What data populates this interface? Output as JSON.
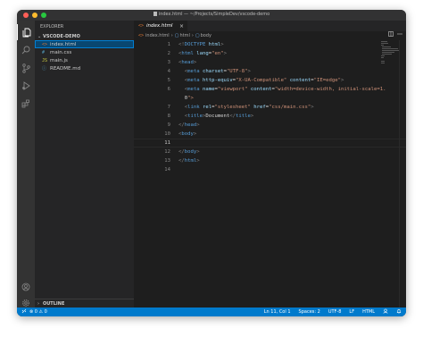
{
  "window": {
    "title": "index.html — ~/Projects/SimpleDev/vscode-demo"
  },
  "colors": {
    "accent": "#007acc",
    "selection": "#094771",
    "traffic_close": "#ff5f57",
    "traffic_min": "#febc2e",
    "traffic_max": "#28c840"
  },
  "activity_bar": {
    "icons": [
      "files-icon",
      "search-icon",
      "source-control-icon",
      "run-debug-icon",
      "extensions-icon",
      "account-icon",
      "settings-gear-icon"
    ]
  },
  "sidebar": {
    "title": "EXPLORER",
    "folder": "VSCODE-DEMO",
    "folder_chevron": "⌄",
    "files": [
      {
        "name": "index.html",
        "icon": "<>",
        "icon_color": "#e37933",
        "selected": true
      },
      {
        "name": "main.css",
        "icon": "#",
        "icon_color": "#519aba",
        "selected": false
      },
      {
        "name": "main.js",
        "icon": "JS",
        "icon_color": "#cbcb41",
        "selected": false
      },
      {
        "name": "README.md",
        "icon": "ⓘ",
        "icon_color": "#519aba",
        "selected": false
      }
    ],
    "outline": {
      "label": "OUTLINE",
      "chevron": "›"
    }
  },
  "editor": {
    "tab": {
      "label": "index.html",
      "icon": "<>",
      "close": "×"
    },
    "breadcrumbs": {
      "file": "index.html",
      "separator": "›",
      "item1": "html",
      "item2": "body"
    },
    "lines": [
      {
        "n": "1",
        "text": "<!DOCTYPE html>"
      },
      {
        "n": "2",
        "text": "<html lang=\"en\">"
      },
      {
        "n": "3",
        "text": "<head>"
      },
      {
        "n": "4",
        "text": "  <meta charset=\"UTF-8\">"
      },
      {
        "n": "5",
        "text": "  <meta http-equiv=\"X-UA-Compatible\" content=\"IE=edge\">"
      },
      {
        "n": "6",
        "text": "  <meta name=\"viewport\" content=\"width=device-width, initial-scale=1."
      },
      {
        "n": "",
        "text": "  0\">"
      },
      {
        "n": "7",
        "text": "  <link rel=\"stylesheet\" href=\"css/main.css\">"
      },
      {
        "n": "8",
        "text": "  <title>Document</title>"
      },
      {
        "n": "9",
        "text": "</head>"
      },
      {
        "n": "10",
        "text": "<body>"
      },
      {
        "n": "11",
        "text": ""
      },
      {
        "n": "12",
        "text": "</body>"
      },
      {
        "n": "13",
        "text": "</html>"
      },
      {
        "n": "14",
        "text": ""
      }
    ]
  },
  "statusbar": {
    "problems": "⊗ 0 ⚠ 0",
    "position": "Ln 11, Col 1",
    "spaces": "Spaces: 2",
    "encoding": "UTF-8",
    "eol": "LF",
    "language": "HTML"
  }
}
